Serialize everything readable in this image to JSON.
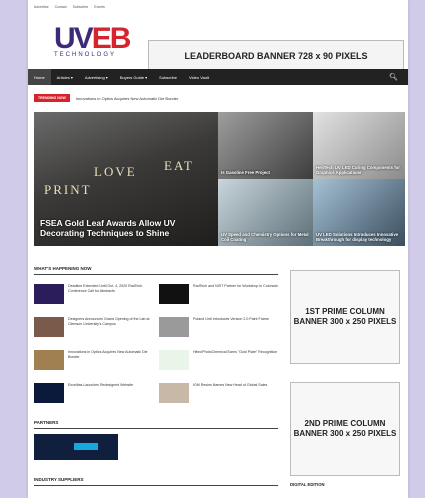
{
  "topbar": {
    "items": [
      "Advertise",
      "Contact",
      "Subscribe",
      "Events"
    ]
  },
  "logo": {
    "main_a": "UV",
    "main_b": "EB",
    "sub": "TECHNOLOGY"
  },
  "leaderboard": {
    "text": "LEADERBOARD BANNER 728 x 90 PIXELS"
  },
  "nav": {
    "items": [
      "Home",
      "Articles ▾",
      "Advertising ▾",
      "Buyers Guide ▾",
      "Subscribe",
      "Video Vault"
    ],
    "search_icon": "search-icon"
  },
  "trending": {
    "badge": "TRENDING NOW",
    "text": "Innovations in Optics Acquires New Automatic Die Bonder"
  },
  "hero": {
    "word_print": "PRINT",
    "word_love": "LOVE",
    "word_eat": "EAT",
    "caption": "FSEA Gold Leaf Awards Allow UV Decorating Techniques to Shine"
  },
  "tiles": [
    {
      "caption": "Is Gasoline Free Project"
    },
    {
      "caption": "HeliTech UV LED Curing Components for Graphics Applications"
    },
    {
      "caption": "UV Speed and Chemistry Options for Metal Coil Coating"
    },
    {
      "caption": "UV LED Solutions Introduces Innovative Breakthrough for display technology"
    }
  ],
  "whats_happening": {
    "title": "WHAT'S HAPPENING NOW",
    "items": [
      {
        "text": "Deadline Extended Until Oct. 4, 2020 RadTech Conference Call for Abstracts"
      },
      {
        "text": "RadTech and NIST Partner for Workshop in Colorado"
      },
      {
        "text": "Designers Announces Grand Opening of the Lab at Clemson University's Campus"
      },
      {
        "text": "Poland Unit Introduces Version 2.0 Paint Frame"
      },
      {
        "text": "Innovations in Optics Acquires New Automatic Die Bonder"
      },
      {
        "text": "Hitec/PhotoChemical Earns \"Gold Plate\" Recognition"
      },
      {
        "text": "Excelitas Launches Redesigned Website"
      },
      {
        "text": "IGM Resins Names New Head of Global Sales"
      }
    ]
  },
  "side": {
    "banner1": "1ST PRIME COLUMN BANNER 300 x 250 PIXELS",
    "banner2": "2ND PRIME COLUMN BANNER 300 x 250 PIXELS",
    "digital": "DIGITAL EDITION"
  },
  "partners": {
    "title": "PARTNERS"
  },
  "suppliers": {
    "title": "INDUSTRY SUPPLIERS"
  }
}
